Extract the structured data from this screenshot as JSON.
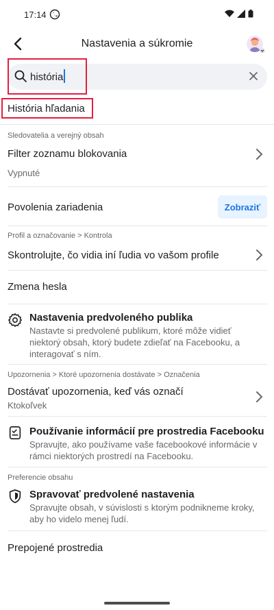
{
  "status": {
    "time": "17:14"
  },
  "header": {
    "title": "Nastavenia a súkromie"
  },
  "search": {
    "value": "história"
  },
  "results": {
    "search_history": "História hľadania",
    "followers_section": "Sledovatelia a verejný obsah",
    "block_filter": {
      "title": "Filter zoznamu blokovania",
      "sub": "Vypnuté"
    },
    "device_permissions": {
      "title": "Povolenia zariadenia",
      "button": "Zobraziť"
    },
    "profile_section": "Profil a označovanie > Kontrola",
    "review_profile": "Skontrolujte, čo vidia iní ľudia vo vašom profile",
    "change_password": "Zmena hesla",
    "default_audience": {
      "title": "Nastavenia predvoleného publika",
      "desc": "Nastavte si predvolené publikum, ktoré môže vidieť niektorý obsah, ktorý budete zdieľať na Facebooku, a interagovať s ním."
    },
    "notifications_section": "Upozornenia > Ktoré upozornenia dostávate > Označenia",
    "tag_notifications": {
      "title": "Dostávať upozornenia, keď vás označí",
      "sub": "Ktokoľvek"
    },
    "info_usage": {
      "title": "Používanie informácií pre prostredia Facebooku",
      "desc": "Spravujte, ako používame vaše facebookové informácie v rámci niektorých prostredí na Facebooku."
    },
    "content_section": "Preferencie obsahu",
    "manage_defaults": {
      "title": "Spravovať predvolené nastavenia",
      "desc": "Spravujte obsah, v súvislosti s ktorým podnikneme kroky, aby ho videlo menej ľudí."
    },
    "connected_experiences": "Prepojené prostredia"
  },
  "colors": {
    "accent": "#1b74e4",
    "highlight": "#e41e3f"
  }
}
